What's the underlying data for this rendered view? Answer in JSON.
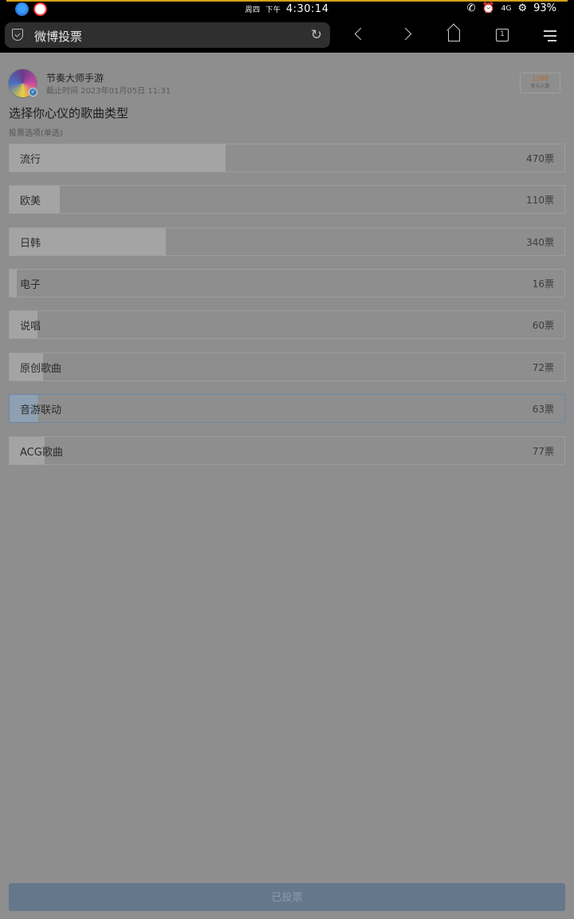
{
  "status_bar": {
    "weekday": "周四",
    "ampm": "下午",
    "time": "4:30:14",
    "network": "4G",
    "battery": "93%"
  },
  "browser": {
    "url_title": "微博投票",
    "tabs_count": "1"
  },
  "poll": {
    "account_name": "节奏大师手游",
    "deadline": "截止时间 2023年01月05日 11:31",
    "participants_count": "1208",
    "participants_label": "参与人数",
    "title": "选择你心仪的歌曲类型",
    "subtitle": "投票选项(单选)",
    "options": [
      {
        "label": "流行",
        "votes": "470票",
        "count": 470
      },
      {
        "label": "欧美",
        "votes": "110票",
        "count": 110
      },
      {
        "label": "日韩",
        "votes": "340票",
        "count": 340
      },
      {
        "label": "电子",
        "votes": "16票",
        "count": 16
      },
      {
        "label": "说唱",
        "votes": "60票",
        "count": 60
      },
      {
        "label": "原创歌曲",
        "votes": "72票",
        "count": 72
      },
      {
        "label": "音游联动",
        "votes": "63票",
        "count": 63,
        "selected": true
      },
      {
        "label": "ACG歌曲",
        "votes": "77票",
        "count": 77
      }
    ],
    "button_label": "已投票"
  },
  "colors": {
    "accent": "#d4a017",
    "selected_border": "#6a87a8",
    "button_bg": "#65778a"
  }
}
